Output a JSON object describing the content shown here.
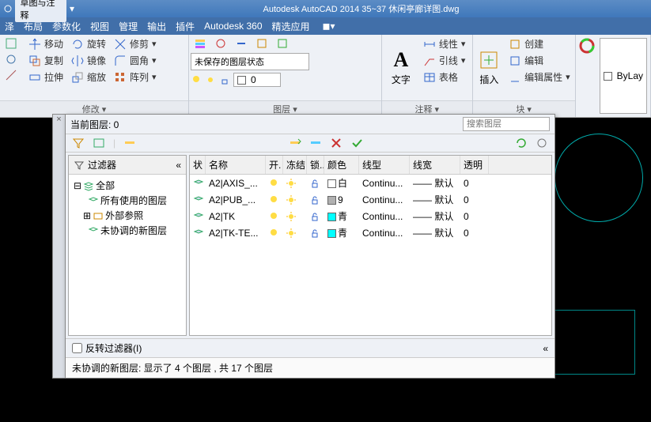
{
  "title": "Autodesk AutoCAD 2014    35~37 休闲亭廊详图.dwg",
  "workspace": "草图与注释",
  "menus": [
    "泽",
    "布局",
    "参数化",
    "视图",
    "管理",
    "输出",
    "插件",
    "Autodesk 360",
    "精选应用"
  ],
  "ribbon": {
    "modify": {
      "title": "修改 ▾",
      "items": {
        "move": "移动",
        "rotate": "旋转",
        "trim": "修剪",
        "copy": "复制",
        "mirror": "镜像",
        "fillet": "圆角",
        "stretch": "拉伸",
        "scale": "缩放",
        "array": "阵列"
      }
    },
    "layer": {
      "title": "图层 ▾",
      "state": "未保存的图层状态",
      "combo_color": "0"
    },
    "annot": {
      "title": "注释 ▾",
      "text": "文字",
      "linear": "线性",
      "leader": "引线",
      "table": "表格"
    },
    "block": {
      "title": "块 ▾",
      "insert": "插入",
      "create": "创建",
      "edit": "编辑",
      "editattr": "编辑属性"
    },
    "prop": {
      "bylayer": "ByLay"
    }
  },
  "layerpal": {
    "current_label": "当前图层: 0",
    "search_ph": "搜索图层",
    "filter_head": "过滤器",
    "tree": {
      "all": "全部",
      "used": "所有使用的图层",
      "xref": "外部参照",
      "unrec": "未协调的新图层"
    },
    "cols": {
      "st": "状",
      "name": "名称",
      "on": "开.",
      "fr": "冻结",
      "lk": "锁..",
      "co": "颜色",
      "lt": "线型",
      "lw": "线宽",
      "tr": "透明"
    },
    "rows": [
      {
        "name": "A2|AXIS_...",
        "color": "白",
        "hex": "#ffffff",
        "lt": "Continu...",
        "lw": "—— 默认",
        "tr": "0"
      },
      {
        "name": "A2|PUB_...",
        "color": "9",
        "hex": "#b0b0b0",
        "lt": "Continu...",
        "lw": "—— 默认",
        "tr": "0"
      },
      {
        "name": "A2|TK",
        "color": "青",
        "hex": "#00ffff",
        "lt": "Continu...",
        "lw": "—— 默认",
        "tr": "0"
      },
      {
        "name": "A2|TK-TE...",
        "color": "青",
        "hex": "#00ffff",
        "lt": "Continu...",
        "lw": "—— 默认",
        "tr": "0"
      }
    ],
    "invert": "反转过滤器(I)",
    "status": "未协调的新图层: 显示了 4 个图层 , 共 17 个图层"
  }
}
